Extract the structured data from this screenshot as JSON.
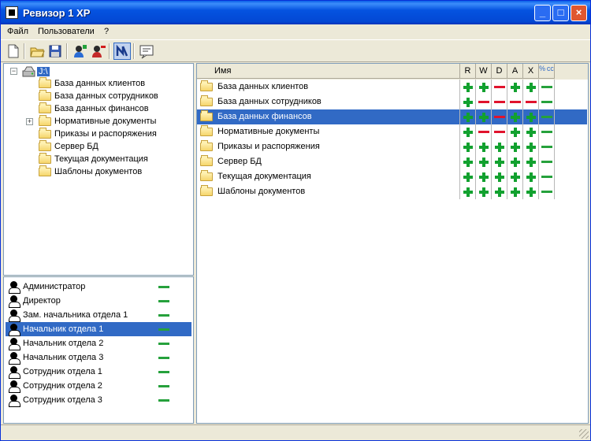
{
  "app": {
    "title": "Ревизор 1 XP"
  },
  "menu": {
    "items": [
      "Файл",
      "Пользователи",
      "?"
    ]
  },
  "toolbar": {
    "icons": [
      "new-file-icon",
      "open-folder-icon",
      "save-icon",
      "user-add-icon",
      "user-remove-icon",
      "audit-icon",
      "report-icon"
    ]
  },
  "tree": {
    "root": "J:\\",
    "items": [
      "База данных клиентов",
      "База данных сотрудников",
      "База данных финансов",
      "Нормативные документы",
      "Приказы и распоряжения",
      "Сервер БД",
      "Текущая документация",
      "Шаблоны документов"
    ]
  },
  "users": {
    "items": [
      "Администратор",
      "Директор",
      "Зам. начальника отдела 1",
      "Начальник отдела 1",
      "Начальник отдела 2",
      "Начальник отдела 3",
      "Сотрудник отдела 1",
      "Сотрудник отдела 2",
      "Сотрудник отдела 3"
    ],
    "selected_index": 3
  },
  "grid": {
    "columns": [
      "Имя",
      "R",
      "W",
      "D",
      "A",
      "X",
      "% cc"
    ],
    "rows": [
      {
        "name": "База данных клиентов",
        "perms": [
          "+",
          "+",
          "-",
          "+",
          "+",
          "-"
        ]
      },
      {
        "name": "База данных сотрудников",
        "perms": [
          "+",
          "-",
          "-",
          "-",
          "-",
          "-"
        ]
      },
      {
        "name": "База данных финансов",
        "perms": [
          "+",
          "+",
          "-",
          "+",
          "+",
          "-"
        ]
      },
      {
        "name": "Нормативные документы",
        "perms": [
          "+",
          "-",
          "-",
          "+",
          "+",
          "-"
        ]
      },
      {
        "name": "Приказы и распоряжения",
        "perms": [
          "+",
          "+",
          "+",
          "+",
          "+",
          "-"
        ]
      },
      {
        "name": "Сервер БД",
        "perms": [
          "+",
          "+",
          "+",
          "+",
          "+",
          "-"
        ]
      },
      {
        "name": "Текущая документация",
        "perms": [
          "+",
          "+",
          "+",
          "+",
          "+",
          "-"
        ]
      },
      {
        "name": "Шаблоны документов",
        "perms": [
          "+",
          "+",
          "+",
          "+",
          "+",
          "-"
        ]
      }
    ],
    "selected_index": 2
  },
  "colors": {
    "selection": "#316ac5",
    "allow": "#12a12f",
    "deny": "#e0132d",
    "neutral": "#26a13c"
  }
}
